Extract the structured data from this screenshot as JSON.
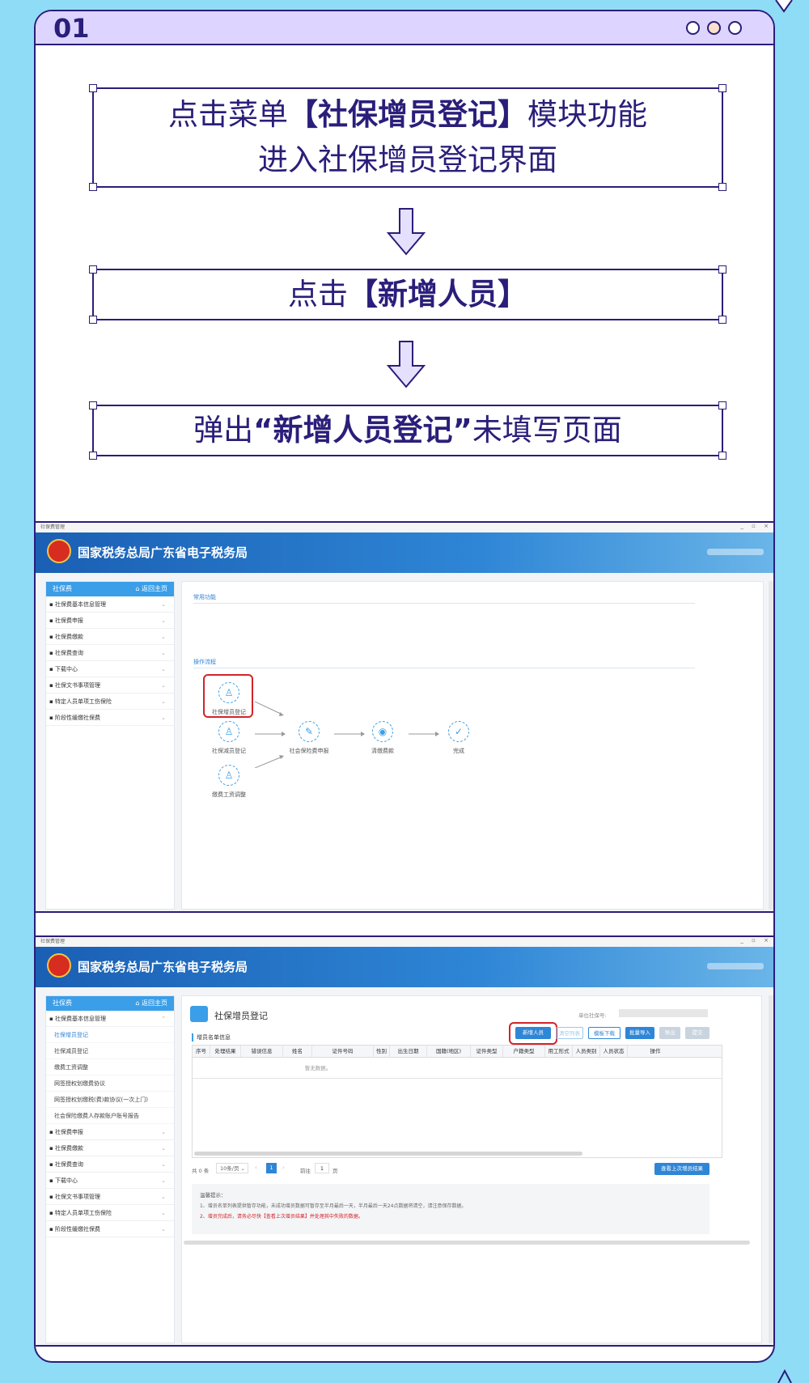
{
  "step": {
    "number": "01",
    "box1": {
      "line1_pre": "点击菜单",
      "line1_bold": "【社保增员登记】",
      "line1_post": "模块功能",
      "line2": "进入社保增员登记界面"
    },
    "box2": {
      "pre": "点击",
      "bold": "【新增人员】"
    },
    "box3": {
      "pre": "弹出",
      "bold": "“新增人员登记”",
      "post": "未填写页面"
    }
  },
  "window1": {
    "titlebar": "社保费管理",
    "controls": "_ ▫ ×",
    "banner_title": "国家税务总局广东省电子税务局",
    "sidebar": {
      "title": "社保费",
      "home_link": "⌂ 返回主页",
      "items": [
        "社保费基本信息管理",
        "社保费申报",
        "社保费缴款",
        "社保费查询",
        "下载中心",
        "社保文书事项管理",
        "特定人员单项工伤保险",
        "阶段性缓缴社保费"
      ]
    },
    "section_common": "常用功能",
    "section_flow": "操作流程",
    "flow": {
      "add": "社保增员登记",
      "reduce": "社保减员登记",
      "adjust": "缴费工资调整",
      "declare": "社会保险费申报",
      "pay": "清缴费款",
      "done": "完成"
    }
  },
  "window2": {
    "titlebar": "社保费管理",
    "controls": "_ ▫ ×",
    "banner_title": "国家税务总局广东省电子税务局",
    "sidebar": {
      "title": "社保费",
      "home_link": "⌂ 返回主页",
      "group": "社保费基本信息管理",
      "subitems": [
        "社保增员登记",
        "社保减员登记",
        "缴费工资调整",
        "网签授权划缴费协议",
        "网签授权划缴税(费)款协议(一次上门)",
        "社会保险缴费人存款账户账号报告"
      ],
      "items": [
        "社保费申报",
        "社保费缴款",
        "社保费查询",
        "下载中心",
        "社保文书事项管理",
        "特定人员单项工伤保险",
        "阶段性缓缴社保费"
      ]
    },
    "page_title": "社保增员登记",
    "unit_label": "单位社保号:",
    "list_title": "增员名单信息",
    "buttons": [
      "新增人员",
      "清空列表",
      "模板下载",
      "批量导入",
      "导出",
      "提交"
    ],
    "columns": [
      "序号",
      "处理结果",
      "错误信息",
      "姓名",
      "证件号码",
      "性别",
      "出生日期",
      "国籍(地区)",
      "证件类型",
      "户籍类型",
      "用工形式",
      "人员类别",
      "人员状态",
      "操作"
    ],
    "empty_text": "暂无数据。",
    "pagination": {
      "total": "共 0 条",
      "page_size": "10条/页",
      "current": "1",
      "goto_label": "前往",
      "goto_value": "1",
      "page_unit": "页"
    },
    "view_last": "查看上次增员结果",
    "tips_title": "温馨提示：",
    "tip1": "1、增员名单列表提供暂存功能，未成功增员数据可暂存至半月最后一天，半月最后一天24点数据将清空，请注意保存数据。",
    "tip2": "2、增员完成后，请务必尽快【查看上次增员结果】并处理其中失败的数据。"
  },
  "colors": {
    "navy": "#2a1e7a",
    "lavender": "#ddd4ff",
    "sky": "#8fdcf7",
    "accent_blue": "#2f86d6",
    "highlight_red": "#d2232a"
  }
}
